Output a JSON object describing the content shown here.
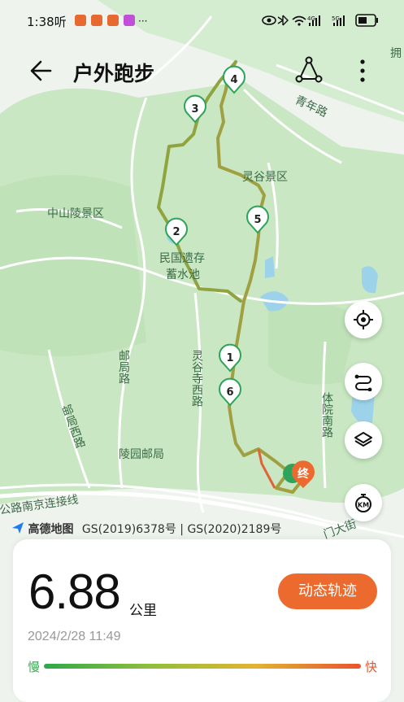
{
  "status_bar": {
    "time": "1:38",
    "extra": "听",
    "network_1": "4G",
    "network_2": "5G"
  },
  "header": {
    "title": "户外跑步"
  },
  "map": {
    "labels": {
      "road_qingnian": "青年路",
      "area_linggu": "灵谷景区",
      "area_zhongshanling": "中山陵景区",
      "site_minguo": "民国遗存",
      "site_xushuichi": "蓄水池",
      "road_youju": "邮局路",
      "road_lingusi": "灵谷寺西路",
      "road_youjuxi": "邮局西路",
      "road_lingyuan": "陵园邮局",
      "road_tiyuannan": "体院南路",
      "road_nanjing": "公路南京连接线",
      "road_corner": "拥",
      "road_dajie": "门大街"
    },
    "km_markers": [
      "1",
      "2",
      "3",
      "4",
      "5",
      "6"
    ],
    "end_marker": "终",
    "attribution_logo": "高德地图",
    "attribution": "GS(2019)6378号 | GS(2020)2189号"
  },
  "summary": {
    "distance": "6.88",
    "unit": "公里",
    "datetime": "2024/2/28 11:49",
    "track_button": "动态轨迹",
    "slow_label": "慢",
    "fast_label": "快"
  },
  "colors": {
    "accent": "#ec6a2e",
    "route": "#9a9a3a",
    "map_green": "#c9e8c4",
    "marker_green": "#2fa35a"
  }
}
